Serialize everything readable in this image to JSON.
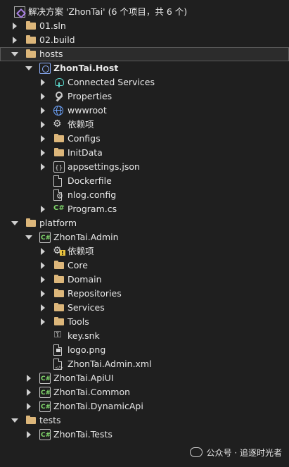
{
  "tree": [
    {
      "label": "解决方案 'ZhonTai' (6 个项目，共 6 个)",
      "icon": "solution-icon",
      "indent": 0,
      "chev": "none"
    },
    {
      "label": "01.sln",
      "icon": "folder-icon",
      "indent": 0,
      "chev": "collapsed"
    },
    {
      "label": "02.build",
      "icon": "folder-icon",
      "indent": 0,
      "chev": "collapsed"
    },
    {
      "label": "hosts",
      "icon": "folder-icon",
      "indent": 0,
      "chev": "expanded",
      "selected": true
    },
    {
      "label": "ZhonTai.Host",
      "icon": "web-project-icon",
      "indent": 1,
      "chev": "expanded",
      "bold": true
    },
    {
      "label": "Connected Services",
      "icon": "connected-services-icon",
      "indent": 2,
      "chev": "collapsed"
    },
    {
      "label": "Properties",
      "icon": "wrench-icon",
      "indent": 2,
      "chev": "collapsed"
    },
    {
      "label": "wwwroot",
      "icon": "globe-icon",
      "indent": 2,
      "chev": "collapsed"
    },
    {
      "label": "依赖项",
      "icon": "dependencies-icon",
      "indent": 2,
      "chev": "collapsed"
    },
    {
      "label": "Configs",
      "icon": "folder-icon",
      "indent": 2,
      "chev": "collapsed"
    },
    {
      "label": "InitData",
      "icon": "folder-icon",
      "indent": 2,
      "chev": "collapsed"
    },
    {
      "label": "appsettings.json",
      "icon": "json-file-icon",
      "indent": 2,
      "chev": "collapsed"
    },
    {
      "label": "Dockerfile",
      "icon": "file-icon",
      "indent": 2,
      "chev": "none"
    },
    {
      "label": "nlog.config",
      "icon": "config-file-icon",
      "indent": 2,
      "chev": "none"
    },
    {
      "label": "Program.cs",
      "icon": "csharp-file-icon",
      "indent": 2,
      "chev": "collapsed"
    },
    {
      "label": "platform",
      "icon": "folder-icon",
      "indent": 0,
      "chev": "expanded"
    },
    {
      "label": "ZhonTai.Admin",
      "icon": "csharp-project-icon",
      "indent": 1,
      "chev": "expanded"
    },
    {
      "label": "依赖项",
      "icon": "dependencies-warning-icon",
      "indent": 2,
      "chev": "collapsed"
    },
    {
      "label": "Core",
      "icon": "folder-icon",
      "indent": 2,
      "chev": "collapsed"
    },
    {
      "label": "Domain",
      "icon": "folder-icon",
      "indent": 2,
      "chev": "collapsed"
    },
    {
      "label": "Repositories",
      "icon": "folder-icon",
      "indent": 2,
      "chev": "collapsed"
    },
    {
      "label": "Services",
      "icon": "folder-icon",
      "indent": 2,
      "chev": "collapsed"
    },
    {
      "label": "Tools",
      "icon": "folder-icon",
      "indent": 2,
      "chev": "collapsed"
    },
    {
      "label": "key.snk",
      "icon": "key-file-icon",
      "indent": 2,
      "chev": "none"
    },
    {
      "label": "logo.png",
      "icon": "image-file-icon",
      "indent": 2,
      "chev": "none"
    },
    {
      "label": "ZhonTai.Admin.xml",
      "icon": "xml-file-icon",
      "indent": 2,
      "chev": "none"
    },
    {
      "label": "ZhonTai.ApiUI",
      "icon": "csharp-project-icon",
      "indent": 1,
      "chev": "collapsed"
    },
    {
      "label": "ZhonTai.Common",
      "icon": "csharp-project-icon",
      "indent": 1,
      "chev": "collapsed"
    },
    {
      "label": "ZhonTai.DynamicApi",
      "icon": "csharp-project-icon",
      "indent": 1,
      "chev": "collapsed"
    },
    {
      "label": "tests",
      "icon": "folder-icon",
      "indent": 0,
      "chev": "expanded"
    },
    {
      "label": "ZhonTai.Tests",
      "icon": "csharp-project-icon",
      "indent": 1,
      "chev": "collapsed"
    }
  ],
  "watermark": "公众号 · 追逐时光者"
}
